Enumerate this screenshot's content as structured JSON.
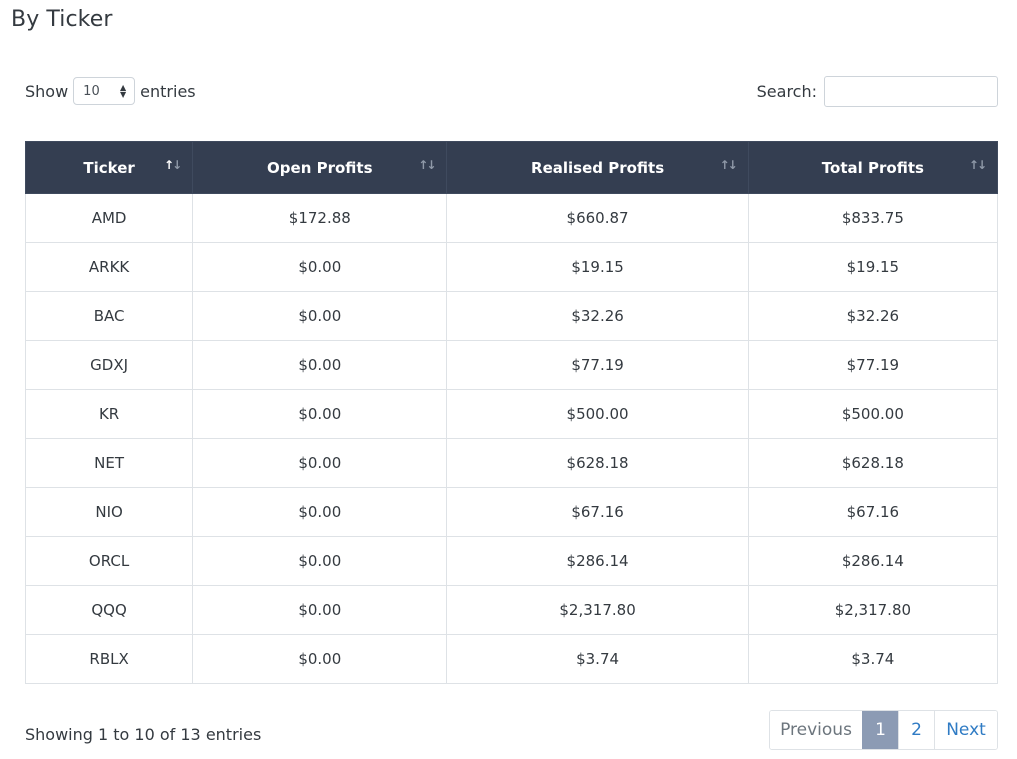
{
  "page": {
    "title": "By Ticker"
  },
  "controls": {
    "show_label": "Show",
    "entries_label": "entries",
    "page_length": "10",
    "search_label": "Search:",
    "search_value": ""
  },
  "table": {
    "columns": [
      "Ticker",
      "Open Profits",
      "Realised Profits",
      "Total Profits"
    ],
    "sort": {
      "column": "Ticker",
      "direction": "ascending"
    },
    "rows": [
      [
        "AMD",
        "$172.88",
        "$660.87",
        "$833.75"
      ],
      [
        "ARKK",
        "$0.00",
        "$19.15",
        "$19.15"
      ],
      [
        "BAC",
        "$0.00",
        "$32.26",
        "$32.26"
      ],
      [
        "GDXJ",
        "$0.00",
        "$77.19",
        "$77.19"
      ],
      [
        "KR",
        "$0.00",
        "$500.00",
        "$500.00"
      ],
      [
        "NET",
        "$0.00",
        "$628.18",
        "$628.18"
      ],
      [
        "NIO",
        "$0.00",
        "$67.16",
        "$67.16"
      ],
      [
        "ORCL",
        "$0.00",
        "$286.14",
        "$286.14"
      ],
      [
        "QQQ",
        "$0.00",
        "$2,317.80",
        "$2,317.80"
      ],
      [
        "RBLX",
        "$0.00",
        "$3.74",
        "$3.74"
      ]
    ]
  },
  "footer": {
    "info": "Showing 1 to 10 of 13 entries",
    "pagination": {
      "previous": "Previous",
      "pages": [
        "1",
        "2"
      ],
      "current": "1",
      "next": "Next"
    }
  },
  "colors": {
    "header_bg": "#343e51",
    "active_page_bg": "#8c9bb4",
    "link": "#2f7bc4"
  },
  "icons": {
    "sort": "sort-arrows-icon",
    "select_caret": "select-caret-icon"
  }
}
